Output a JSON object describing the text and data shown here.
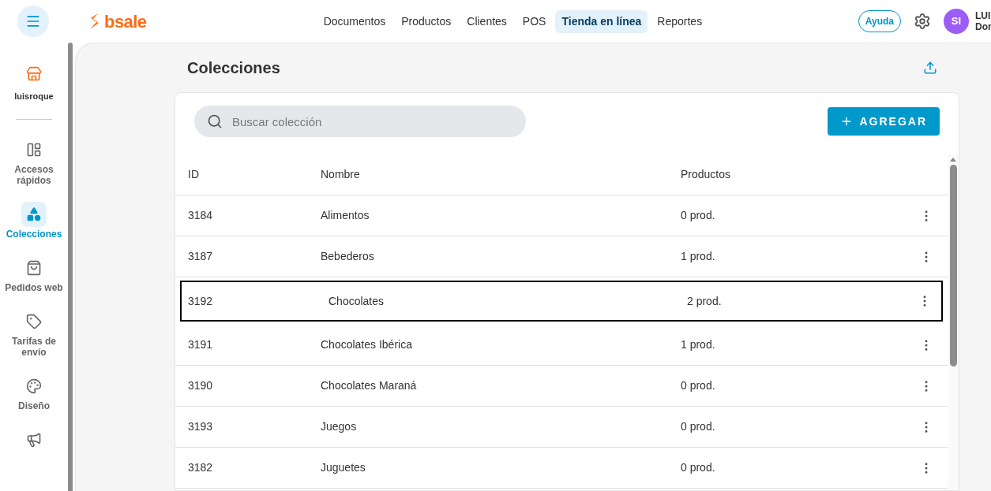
{
  "brand": {
    "name": "bsale"
  },
  "nav": [
    {
      "label": "Documentos",
      "selected": false
    },
    {
      "label": "Productos",
      "selected": false
    },
    {
      "label": "Clientes",
      "selected": false
    },
    {
      "label": "POS",
      "selected": false
    },
    {
      "label": "Tienda en línea",
      "selected": true
    },
    {
      "label": "Reportes",
      "selected": false
    }
  ],
  "help": "Ayuda",
  "user": {
    "initials": "SI",
    "name": "LUI",
    "subtitle": "Dor"
  },
  "store": {
    "name": "luisroque"
  },
  "sidebar": [
    {
      "label": "Accesos rápidos",
      "selected": false
    },
    {
      "label": "Colecciones",
      "selected": true
    },
    {
      "label": "Pedidos web",
      "selected": false
    },
    {
      "label": "Tarifas de envío",
      "selected": false
    },
    {
      "label": "Diseño",
      "selected": false
    },
    {
      "selected": false
    }
  ],
  "page": {
    "title": "Colecciones",
    "search": {
      "placeholder": "Buscar colección"
    },
    "add_button": "AGREGAR"
  },
  "table": {
    "columns": [
      "ID",
      "Nombre",
      "Productos"
    ],
    "rows": [
      {
        "id": "3184",
        "name": "Alimentos",
        "products": "0 prod.",
        "selected": false
      },
      {
        "id": "3187",
        "name": "Bebederos",
        "products": "1 prod.",
        "selected": false
      },
      {
        "id": "3192",
        "name": "Chocolates",
        "products": "2 prod.",
        "selected": true
      },
      {
        "id": "3191",
        "name": "Chocolates Ibérica",
        "products": "1 prod.",
        "selected": false
      },
      {
        "id": "3190",
        "name": "Chocolates Maraná",
        "products": "0 prod.",
        "selected": false
      },
      {
        "id": "3193",
        "name": "Juegos",
        "products": "0 prod.",
        "selected": false
      },
      {
        "id": "3182",
        "name": "Juguetes",
        "products": "0 prod.",
        "selected": false
      }
    ]
  }
}
